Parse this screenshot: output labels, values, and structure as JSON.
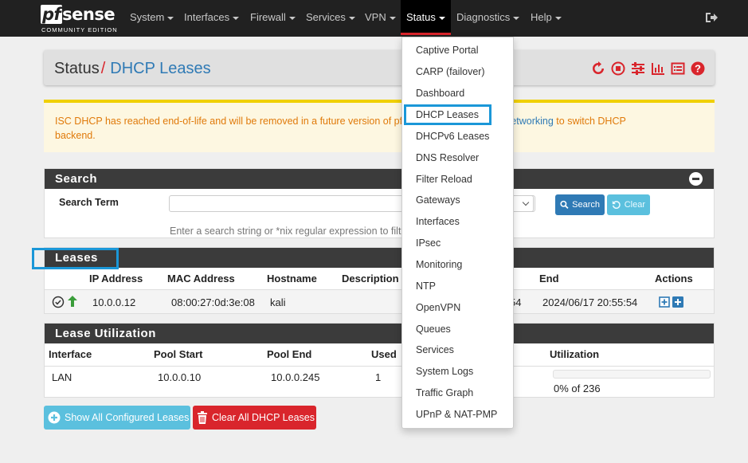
{
  "brand": {
    "name": "pfsense",
    "edition": "COMMUNITY EDITION"
  },
  "nav": {
    "items": [
      "System",
      "Interfaces",
      "Firewall",
      "Services",
      "VPN",
      "Status",
      "Diagnostics",
      "Help"
    ],
    "active": "Status"
  },
  "breadcrumb": {
    "parent": "Status",
    "separator": "/",
    "current": "DHCP Leases"
  },
  "alert": {
    "text_start": "ISC DHCP has reached end-of-life and will be removed in a future version of pfS",
    "link_text": "anced > Networking",
    "text_end": " to switch DHCP",
    "text_line2": "backend."
  },
  "search_panel": {
    "title": "Search",
    "label": "Search Term",
    "help": "Enter a search string or *nix regular expression to filt",
    "search_button": "Search",
    "clear_button": "Clear"
  },
  "leases_panel": {
    "title": "Leases",
    "columns": [
      "IP Address",
      "MAC Address",
      "Hostname",
      "Description",
      "End",
      "Actions"
    ],
    "rows": [
      {
        "ip": "10.0.0.12",
        "mac": "08:00:27:0d:3e:08",
        "hostname": "kali",
        "start_fragment": "54",
        "end": "2024/06/17 20:55:54"
      }
    ]
  },
  "utilization_panel": {
    "title": "Lease Utilization",
    "columns": [
      "Interface",
      "Pool Start",
      "Pool End",
      "Used",
      "Utilization"
    ],
    "rows": [
      {
        "interface": "LAN",
        "pool_start": "10.0.0.10",
        "pool_end": "10.0.0.245",
        "used": "1",
        "utilization": "0% of 236",
        "utilization_fraction": 0.0
      }
    ]
  },
  "buttons": {
    "show_all": "Show All Configured Leases",
    "clear_all": "Clear All DHCP Leases"
  },
  "status_menu": [
    "Captive Portal",
    "CARP (failover)",
    "Dashboard",
    "DHCP Leases",
    "DHCPv6 Leases",
    "DNS Resolver",
    "Filter Reload",
    "Gateways",
    "Interfaces",
    "IPsec",
    "Monitoring",
    "NTP",
    "OpenVPN",
    "Queues",
    "Services",
    "System Logs",
    "Traffic Graph",
    "UPnP & NAT-PMP"
  ],
  "colors": {
    "accent": "#2f7ab5",
    "danger": "#d9252c",
    "highlight": "#1b97d8",
    "navbar": "#212121"
  }
}
